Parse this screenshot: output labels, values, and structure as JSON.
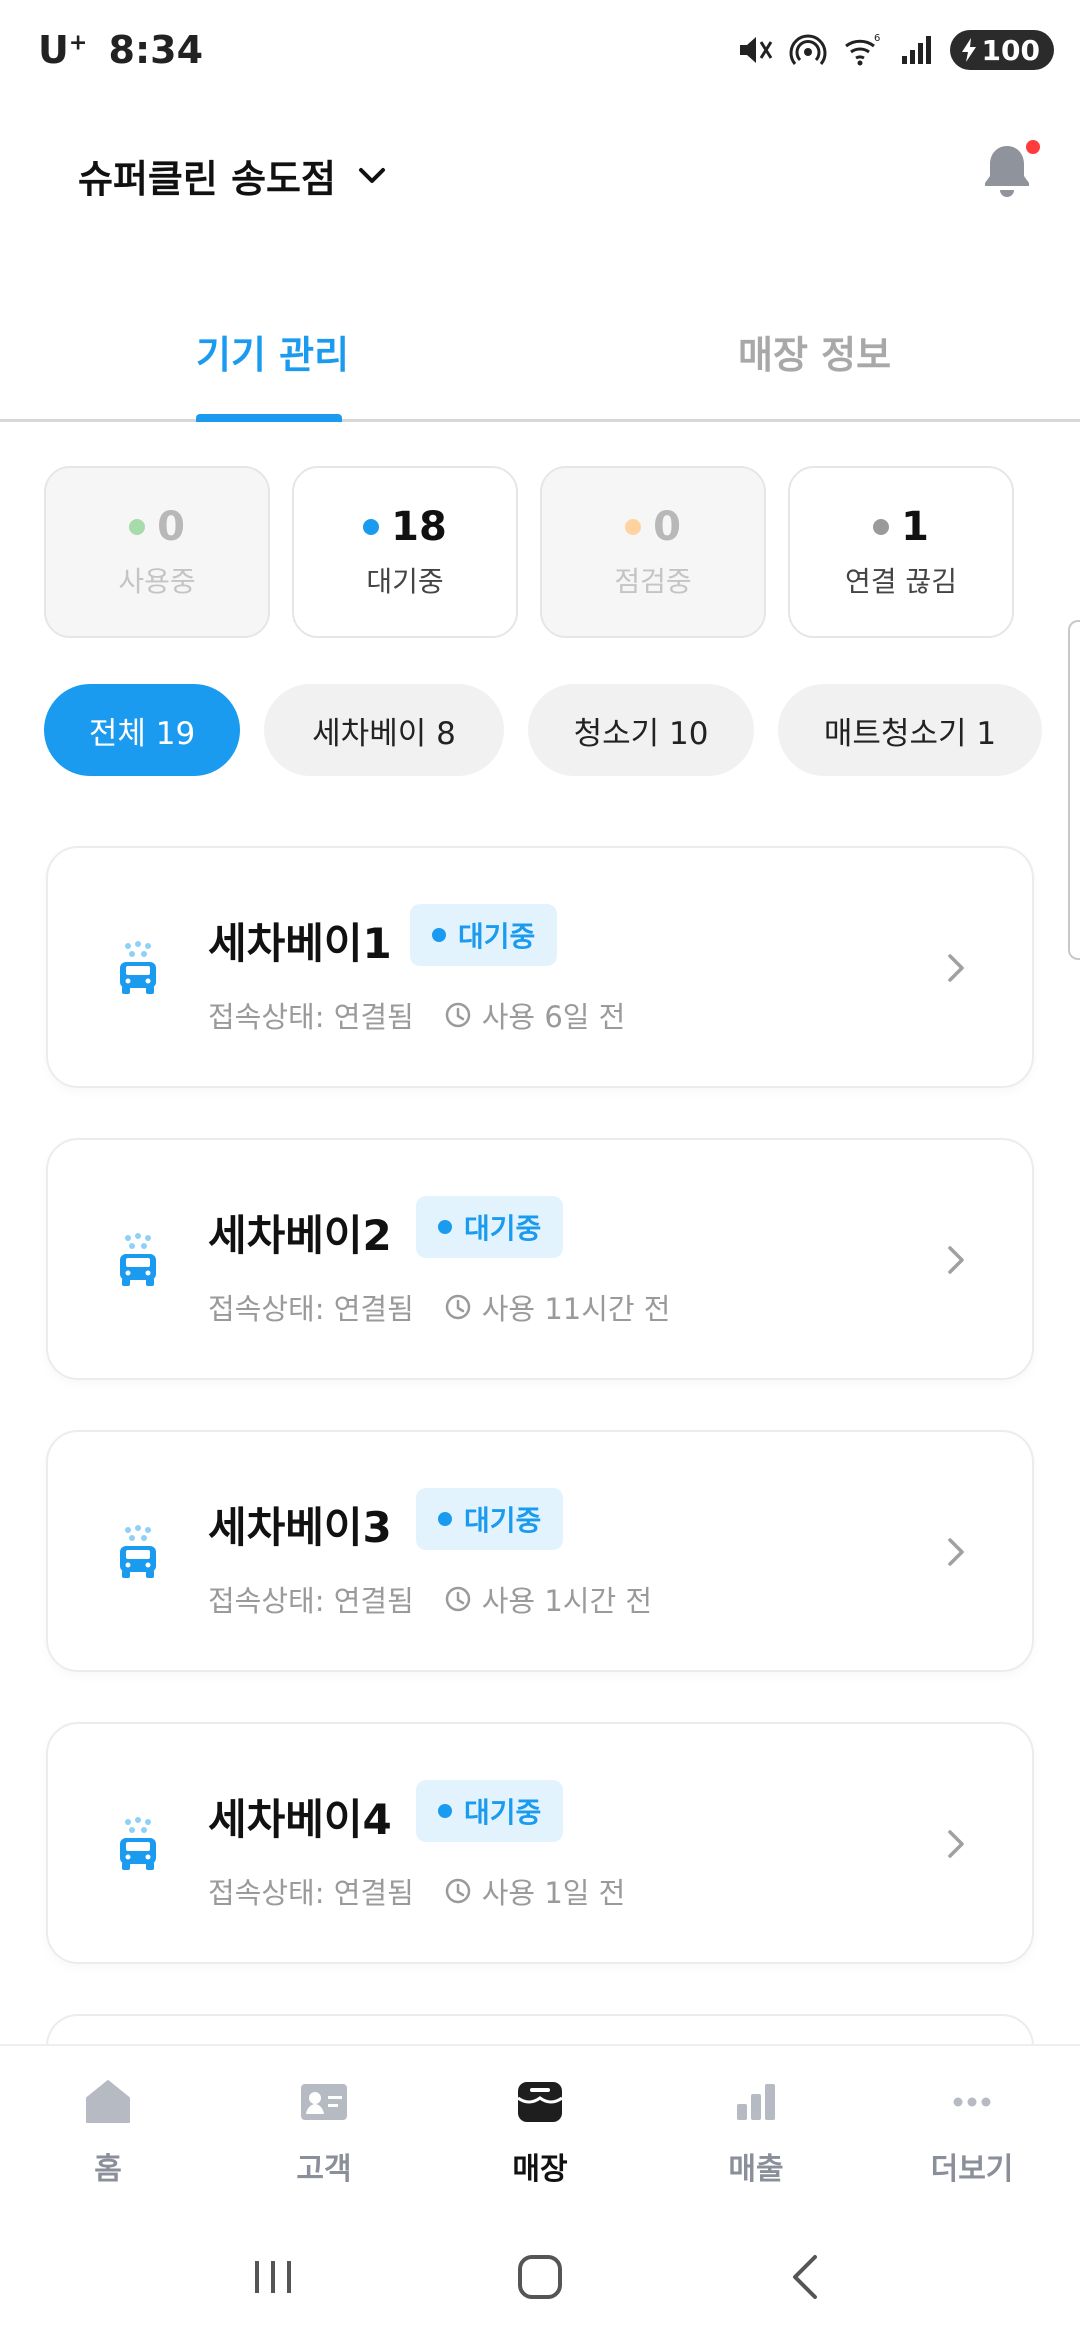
{
  "status_bar": {
    "carrier": "U",
    "carrier_sup": "+",
    "time": "8:34",
    "battery": "100",
    "wifi_badge": "6"
  },
  "header": {
    "store_name": "슈퍼클린 송도점"
  },
  "tabs": [
    {
      "label": "기기 관리",
      "active": true
    },
    {
      "label": "매장 정보",
      "active": false
    }
  ],
  "stats": [
    {
      "value": "0",
      "label": "사용중",
      "dot_color": "#a6dca9"
    },
    {
      "value": "18",
      "label": "대기중",
      "dot_color": "#1a9bf0"
    },
    {
      "value": "0",
      "label": "점검중",
      "dot_color": "#ffd3a0"
    },
    {
      "value": "1",
      "label": "연결 끊김",
      "dot_color": "#9a9a9a"
    }
  ],
  "filters": [
    {
      "label": "전체 19",
      "active": true
    },
    {
      "label": "세차베이 8",
      "active": false
    },
    {
      "label": "청소기 10",
      "active": false
    },
    {
      "label": "매트청소기 1",
      "active": false
    }
  ],
  "devices": [
    {
      "name": "세차베이1",
      "status": "대기중",
      "connection": "접속상태: 연결됨",
      "last_used": "사용 6일 전"
    },
    {
      "name": "세차베이2",
      "status": "대기중",
      "connection": "접속상태: 연결됨",
      "last_used": "사용 11시간 전"
    },
    {
      "name": "세차베이3",
      "status": "대기중",
      "connection": "접속상태: 연결됨",
      "last_used": "사용 1시간 전"
    },
    {
      "name": "세차베이4",
      "status": "대기중",
      "connection": "접속상태: 연결됨",
      "last_used": "사용 1일 전"
    }
  ],
  "bottom_nav": [
    {
      "label": "홈",
      "icon": "home-icon",
      "active": false
    },
    {
      "label": "고객",
      "icon": "customer-card-icon",
      "active": false
    },
    {
      "label": "매장",
      "icon": "store-icon",
      "active": true
    },
    {
      "label": "매출",
      "icon": "bar-chart-icon",
      "active": false
    },
    {
      "label": "더보기",
      "icon": "more-dots-icon",
      "active": false
    }
  ],
  "colors": {
    "accent": "#1a9bf0",
    "badge_bg": "#e3f3fd",
    "notification_dot": "#ff3b3b"
  }
}
